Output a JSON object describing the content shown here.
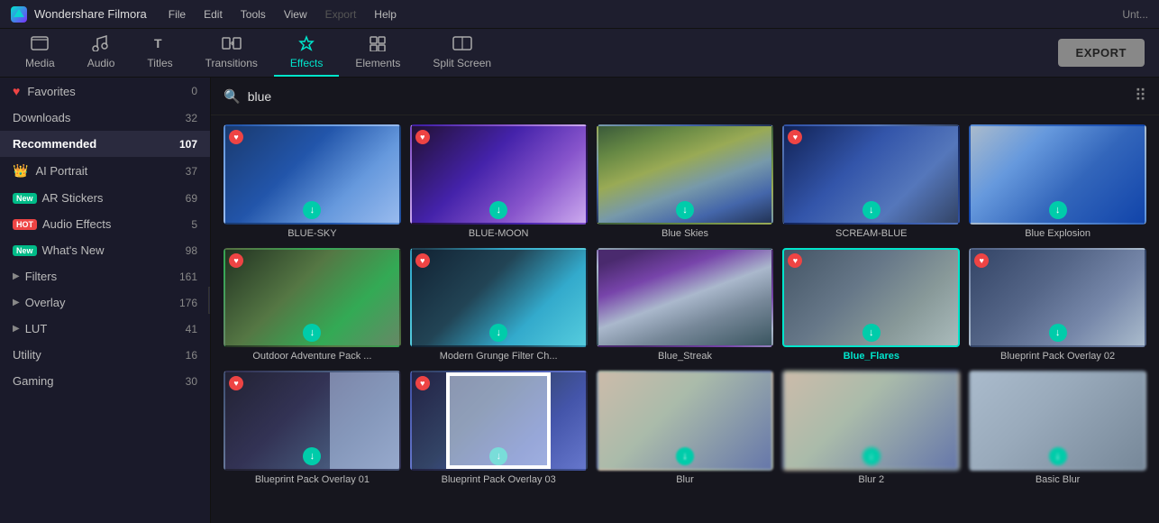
{
  "app": {
    "name": "Wondershare Filmora",
    "logo": "W"
  },
  "titlebar": {
    "menus": [
      "File",
      "Edit",
      "Tools",
      "View",
      "Export",
      "Help"
    ],
    "export_gray": "Export"
  },
  "toolbar": {
    "items": [
      {
        "id": "media",
        "label": "Media",
        "icon": "☐"
      },
      {
        "id": "audio",
        "label": "Audio",
        "icon": "♪"
      },
      {
        "id": "titles",
        "label": "Titles",
        "icon": "T"
      },
      {
        "id": "transitions",
        "label": "Transitions",
        "icon": "⇄"
      },
      {
        "id": "effects",
        "label": "Effects",
        "icon": "✦"
      },
      {
        "id": "elements",
        "label": "Elements",
        "icon": "⊞"
      },
      {
        "id": "splitscreen",
        "label": "Split Screen",
        "icon": "⊟"
      }
    ],
    "active": "effects",
    "export_btn": "EXPORT"
  },
  "sidebar": {
    "items": [
      {
        "id": "favorites",
        "label": "Favorites",
        "count": "0",
        "icon": "heart",
        "type": "normal"
      },
      {
        "id": "downloads",
        "label": "Downloads",
        "count": "32",
        "icon": null,
        "type": "normal"
      },
      {
        "id": "recommended",
        "label": "Recommended",
        "count": "107",
        "icon": null,
        "type": "active"
      },
      {
        "id": "ai-portrait",
        "label": "AI Portrait",
        "count": "37",
        "icon": "crown",
        "type": "normal"
      },
      {
        "id": "ar-stickers",
        "label": "AR Stickers",
        "count": "69",
        "icon": "new",
        "type": "normal"
      },
      {
        "id": "audio-effects",
        "label": "Audio Effects",
        "count": "5",
        "icon": "hot",
        "type": "normal"
      },
      {
        "id": "whats-new",
        "label": "What's New",
        "count": "98",
        "icon": "new",
        "type": "normal"
      },
      {
        "id": "filters",
        "label": "Filters",
        "count": "161",
        "icon": "arrow",
        "type": "normal"
      },
      {
        "id": "overlay",
        "label": "Overlay",
        "count": "176",
        "icon": "arrow",
        "type": "normal"
      },
      {
        "id": "lut",
        "label": "LUT",
        "count": "41",
        "icon": "arrow",
        "type": "normal"
      },
      {
        "id": "utility",
        "label": "Utility",
        "count": "16",
        "icon": null,
        "type": "normal"
      },
      {
        "id": "gaming",
        "label": "Gaming",
        "count": "30",
        "icon": null,
        "type": "normal"
      }
    ]
  },
  "search": {
    "value": "blue",
    "placeholder": "Search"
  },
  "effects": {
    "items": [
      {
        "id": "blue-sky",
        "label": "BLUE-SKY",
        "thumb": "blue-sky",
        "fav": true,
        "dl": true
      },
      {
        "id": "blue-moon",
        "label": "BLUE-MOON",
        "thumb": "blue-moon",
        "fav": true,
        "dl": true
      },
      {
        "id": "blue-skies",
        "label": "Blue Skies",
        "thumb": "blue-skies",
        "fav": false,
        "dl": true
      },
      {
        "id": "scream-blue",
        "label": "SCREAM-BLUE",
        "thumb": "scream-blue",
        "fav": true,
        "dl": true
      },
      {
        "id": "blue-explosion",
        "label": "Blue Explosion",
        "thumb": "blue-explosion",
        "fav": false,
        "dl": true
      },
      {
        "id": "outdoor",
        "label": "Outdoor Adventure Pack ...",
        "thumb": "outdoor",
        "fav": true,
        "dl": true
      },
      {
        "id": "modern-grunge",
        "label": "Modern Grunge Filter Ch...",
        "thumb": "modern-grunge",
        "fav": true,
        "dl": true
      },
      {
        "id": "blue-streak",
        "label": "Blue_Streak",
        "thumb": "blue-streak",
        "fav": false,
        "dl": false
      },
      {
        "id": "blue-flares",
        "label": "Blue_Flares",
        "thumb": "blue-flares",
        "fav": true,
        "dl": true,
        "selected": true
      },
      {
        "id": "blueprint02",
        "label": "Blueprint Pack Overlay 02",
        "thumb": "blueprint02",
        "fav": true,
        "dl": true
      },
      {
        "id": "blueprint01",
        "label": "Blueprint Pack Overlay 01",
        "thumb": "blueprint01",
        "fav": true,
        "dl": true
      },
      {
        "id": "blueprint03",
        "label": "Blueprint Pack Overlay 03",
        "thumb": "blueprint03",
        "fav": true,
        "dl": true
      },
      {
        "id": "blur",
        "label": "Blur",
        "thumb": "blur",
        "fav": false,
        "dl": true
      },
      {
        "id": "blur2",
        "label": "Blur 2",
        "thumb": "blur2",
        "fav": false,
        "dl": true
      },
      {
        "id": "basic-blur",
        "label": "Basic Blur",
        "thumb": "basic-blur",
        "fav": false,
        "dl": true
      }
    ]
  }
}
